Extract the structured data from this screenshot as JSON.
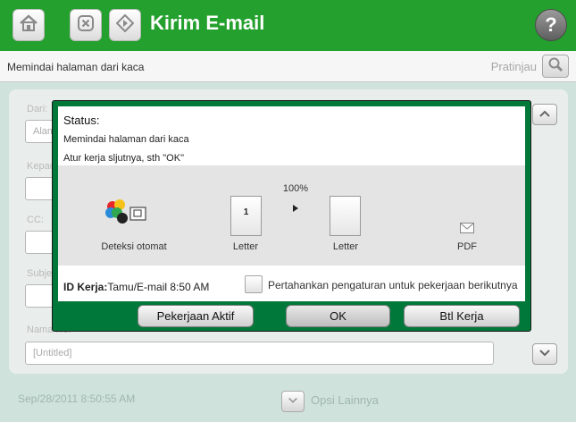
{
  "header": {
    "title": "Kirim E-mail",
    "home_icon": "home-icon",
    "stop_icon": "stop-icon",
    "start_icon": "start-icon",
    "help_icon": "help-icon",
    "help_glyph": "?"
  },
  "status_bar": {
    "message": "Memindai halaman dari kaca",
    "preview_label": "Pratinjau",
    "preview_icon": "magnifier-icon"
  },
  "form": {
    "fields": [
      {
        "label": "Dari:",
        "value": "Alamat"
      },
      {
        "label": "Kepada:",
        "value": ""
      },
      {
        "label": "CC:",
        "value": ""
      },
      {
        "label": "Subjek:",
        "value": ""
      },
      {
        "label": "Nama file:",
        "value": "[Untitled]"
      }
    ],
    "scroll_up_icon": "scroll-up-icon",
    "scroll_down_icon": "scroll-down-icon"
  },
  "footer": {
    "timestamp": "Sep/28/2011 8:50:55 AM",
    "more_options_label": "Opsi Lainnya",
    "more_options_icon": "chevron-down-icon"
  },
  "dialog": {
    "status_title": "Status:",
    "line1": "Memindai halaman dari kaca",
    "line2": "Atur kerja sljutnya, sth \"OK\"",
    "detect_label": "Deteksi otomat",
    "scale_label": "100%",
    "source_page_number": "1",
    "source_size_label": "Letter",
    "dest_size_label": "Letter",
    "output_format_label": "PDF",
    "job_id_label": "ID Kerja:",
    "job_id_value": "Tamu/E-mail 8:50 AM",
    "keep_settings_label": "Pertahankan pengaturan untuk pekerjaan berikutnya",
    "keep_settings_checked": false,
    "buttons": {
      "active_jobs": "Pekerjaan Aktif",
      "ok": "OK",
      "cancel_job": "Btl Kerja"
    }
  },
  "colors": {
    "header_green": "#23a02d",
    "dialog_green": "#00783a",
    "background": "#cfe3dc"
  }
}
